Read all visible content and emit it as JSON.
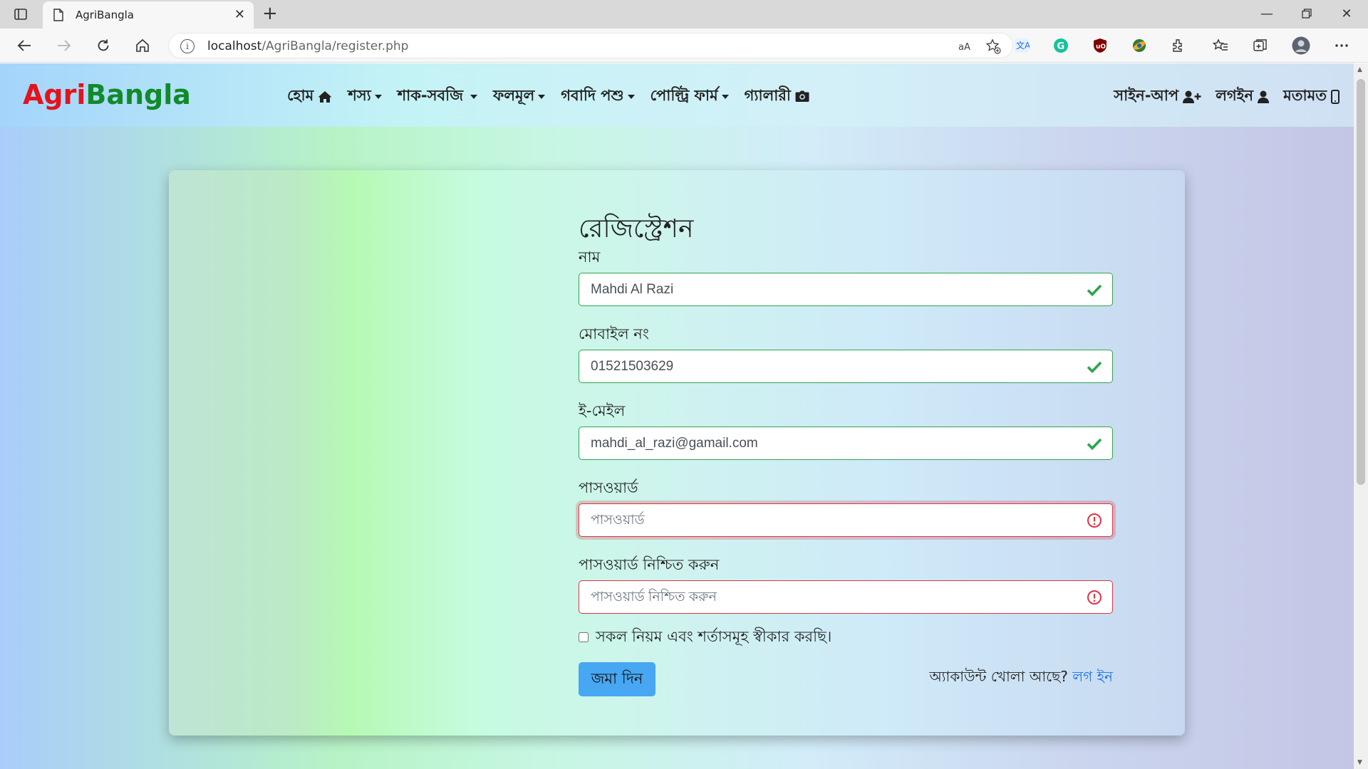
{
  "browser": {
    "tab_title": "AgriBangla",
    "url_host": "localhost",
    "url_path": "/AgriBangla/register.php"
  },
  "site": {
    "brand_part1": "Agri",
    "brand_part2": "Bangla",
    "brand_colors": {
      "agri": "#e3131b",
      "bangla": "#128a2a"
    },
    "menu": [
      {
        "label": "হোম",
        "icon": "home-icon"
      },
      {
        "label": "শস্য",
        "dropdown": true
      },
      {
        "label": "শাক-সবজি",
        "dropdown": true
      },
      {
        "label": "ফলমূল",
        "dropdown": true
      },
      {
        "label": "গবাদি পশু",
        "dropdown": true
      },
      {
        "label": "পোল্ট্রি ফার্ম",
        "dropdown": true
      },
      {
        "label": "গ্যালারী",
        "icon": "camera-icon"
      }
    ],
    "menu_right": [
      {
        "label": "সাইন-আপ",
        "icon": "user-plus-icon"
      },
      {
        "label": "লগইন",
        "icon": "user-icon"
      },
      {
        "label": "মতামত",
        "icon": "mobile-icon"
      }
    ]
  },
  "form": {
    "title": "রেজিস্ট্রেশন",
    "name_label": "নাম",
    "name_value": "Mahdi Al Razi",
    "mobile_label": "মোবাইল নং",
    "mobile_value": "01521503629",
    "email_label": "ই-মেইল",
    "email_value": "mahdi_al_razi@gamail.com",
    "password_label": "পাসওয়ার্ড",
    "password_placeholder": "পাসওয়ার্ড",
    "confirm_label": "পাসওয়ার্ড নিশ্চিত করুন",
    "confirm_placeholder": "পাসওয়ার্ড নিশ্চিত করুন",
    "terms_label": "সকল নিয়ম এবং শর্তাসমূহ স্বীকার করছি।",
    "submit_label": "জমা দিন",
    "account_note": "অ্যাকাউন্ট খোলা আছে?",
    "login_link": "লগ ইন",
    "valid_color": "#2fa44f",
    "invalid_color": "#dc3545"
  }
}
